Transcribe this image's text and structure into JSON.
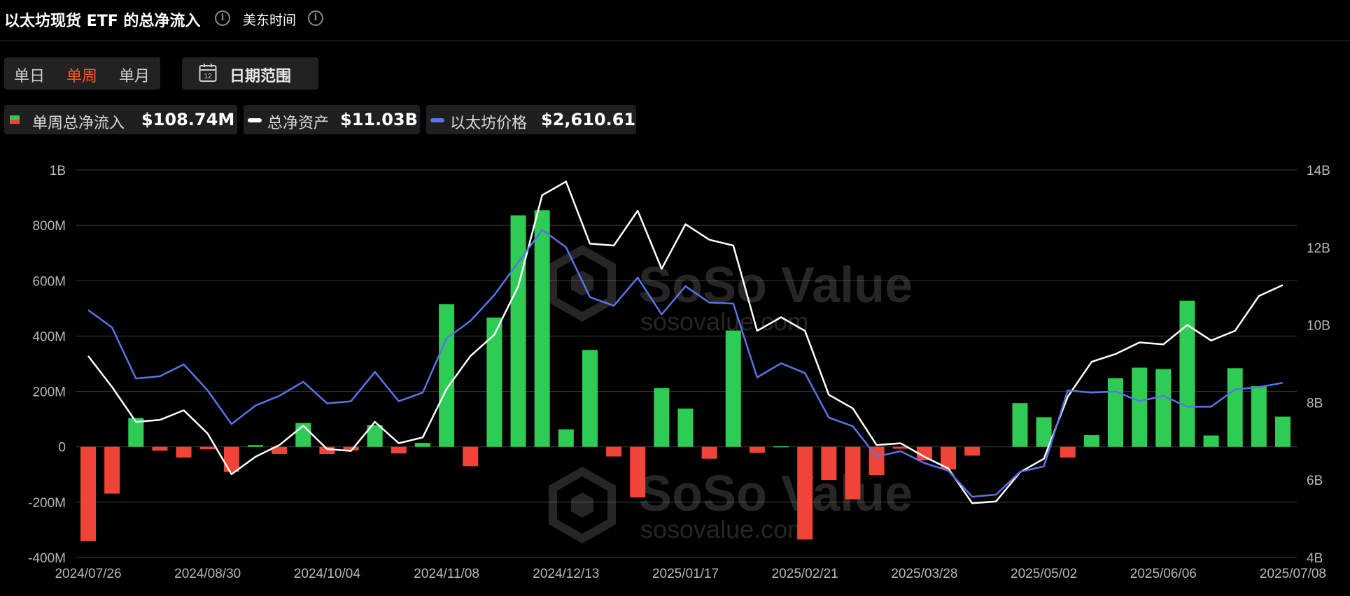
{
  "header": {
    "title": "以太坊现货 ETF 的总净流入",
    "timezone": "美东时间",
    "info_glyph": "i"
  },
  "controls": {
    "periods": [
      "单日",
      "单周",
      "单月"
    ],
    "active_period": "单周",
    "date_range_label": "日期范围",
    "calendar_day": "12"
  },
  "legend": [
    {
      "label": "单周总净流入",
      "value": "$108.74M"
    },
    {
      "label": "总净资产",
      "value": "$11.03B"
    },
    {
      "label": "以太坊价格",
      "value": "$2,610.61"
    }
  ],
  "watermark": {
    "brand": "SoSo Value",
    "url": "sosovalue.com"
  },
  "colors": {
    "inflow": "#2ecc55",
    "outflow": "#f04438",
    "net_assets": "#ffffff",
    "eth_price": "#5b74e6",
    "active_tab": "#ff5a1f",
    "grid": "#3a3a3a"
  },
  "chart_data": {
    "type": "bar+line",
    "x_tick_labels": [
      "2024/07/26",
      "2024/08/30",
      "2024/10/04",
      "2024/11/08",
      "2024/12/13",
      "2025/01/17",
      "2025/02/21",
      "2025/03/28",
      "2025/05/02",
      "2025/06/06",
      "2025/07/08"
    ],
    "y_left": {
      "ticks": [
        "1B",
        "800M",
        "600M",
        "400M",
        "200M",
        "0",
        "-200M",
        "-400M"
      ],
      "range_millions": [
        -400,
        1000
      ]
    },
    "y_right": {
      "ticks": [
        "14B",
        "12B",
        "10B",
        "8B",
        "6B",
        "4B"
      ],
      "range_billions": [
        4,
        14
      ]
    },
    "weeks": [
      "2024/07/26",
      "2024/08/02",
      "2024/08/09",
      "2024/08/16",
      "2024/08/23",
      "2024/08/30",
      "2024/09/06",
      "2024/09/13",
      "2024/09/20",
      "2024/09/27",
      "2024/10/04",
      "2024/10/11",
      "2024/10/18",
      "2024/10/25",
      "2024/11/01",
      "2024/11/08",
      "2024/11/15",
      "2024/11/22",
      "2024/11/29",
      "2024/12/06",
      "2024/12/13",
      "2024/12/20",
      "2024/12/27",
      "2025/01/03",
      "2025/01/10",
      "2025/01/17",
      "2025/01/24",
      "2025/01/31",
      "2025/02/07",
      "2025/02/14",
      "2025/02/21",
      "2025/02/28",
      "2025/03/07",
      "2025/03/14",
      "2025/03/21",
      "2025/03/28",
      "2025/04/04",
      "2025/04/11",
      "2025/04/18",
      "2025/04/25",
      "2025/05/02",
      "2025/05/09",
      "2025/05/16",
      "2025/05/23",
      "2025/05/30",
      "2025/06/06",
      "2025/06/13",
      "2025/06/20",
      "2025/06/27",
      "2025/07/04",
      "2025/07/08"
    ],
    "weekly_net_inflow_millions": [
      -341,
      -169,
      104,
      -14,
      -39,
      -9,
      -91,
      6,
      -26,
      86,
      -26,
      -13,
      78,
      -24,
      14,
      515,
      -70,
      467,
      836,
      855,
      63,
      350,
      -35,
      -183,
      212,
      138,
      -43,
      420,
      -22,
      2,
      -335,
      -120,
      -190,
      -102,
      -7,
      -49,
      -82,
      -32,
      0,
      158,
      107,
      -39,
      42,
      248,
      286,
      281,
      528,
      41,
      284,
      219,
      109
    ],
    "total_net_assets_billions": [
      9.2,
      8.4,
      7.5,
      7.55,
      7.8,
      7.2,
      6.15,
      6.6,
      6.9,
      7.4,
      6.8,
      6.75,
      7.5,
      6.95,
      7.1,
      8.35,
      9.2,
      9.75,
      11.0,
      13.35,
      13.7,
      12.1,
      12.05,
      12.95,
      11.45,
      12.6,
      12.2,
      12.05,
      9.85,
      10.2,
      9.85,
      8.2,
      7.85,
      6.9,
      6.95,
      6.6,
      6.3,
      5.4,
      5.45,
      6.2,
      6.55,
      8.15,
      9.05,
      9.25,
      9.55,
      9.5,
      10.0,
      9.6,
      9.85,
      10.75,
      11.03
    ]
  },
  "eth_price_usd": [
    3280,
    3120,
    2650,
    2670,
    2780,
    2540,
    2230,
    2400,
    2490,
    2620,
    2420,
    2440,
    2710,
    2440,
    2520,
    3020,
    3180,
    3420,
    3720,
    4020,
    3860,
    3400,
    3320,
    3580,
    3240,
    3500,
    3350,
    3340,
    2660,
    2790,
    2700,
    2290,
    2210,
    1930,
    1980,
    1870,
    1800,
    1560,
    1580,
    1790,
    1840,
    2540,
    2520,
    2530,
    2440,
    2490,
    2390,
    2390,
    2550,
    2570,
    2610.61
  ]
}
